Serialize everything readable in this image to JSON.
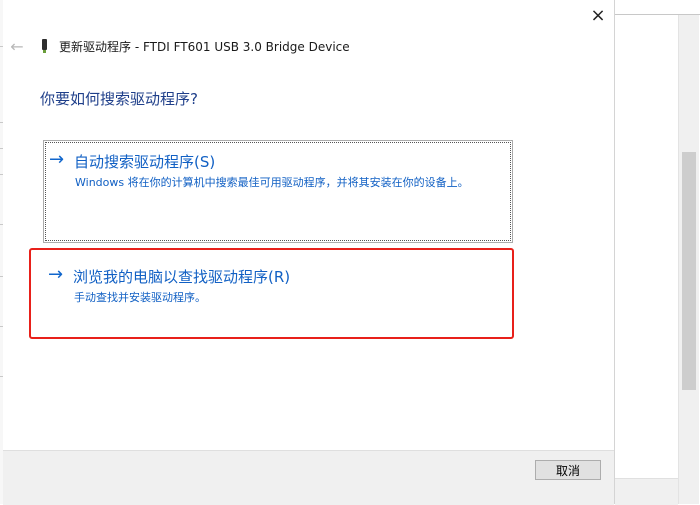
{
  "dialog": {
    "title": "更新驱动程序 - FTDI FT601 USB 3.0 Bridge Device",
    "heading": "你要如何搜索驱动程序?",
    "close_icon": "×",
    "back_icon": "←"
  },
  "options": [
    {
      "arrow": "→",
      "title": "自动搜索驱动程序(S)",
      "description": "Windows 将在你的计算机中搜索最佳可用驱动程序，并将其安装在你的设备上。"
    },
    {
      "arrow": "→",
      "title": "浏览我的电脑以查找驱动程序(R)",
      "description": "手动查找并安装驱动程序。"
    }
  ],
  "footer": {
    "cancel_label": "取消"
  },
  "colors": {
    "link_blue": "#1160c4",
    "heading_blue": "#1f3f8a",
    "highlight_red": "#e8201a"
  },
  "icons": {
    "close": "close-icon",
    "back": "back-arrow-icon",
    "device": "usb-device-icon",
    "option_arrow": "arrow-right-icon"
  }
}
